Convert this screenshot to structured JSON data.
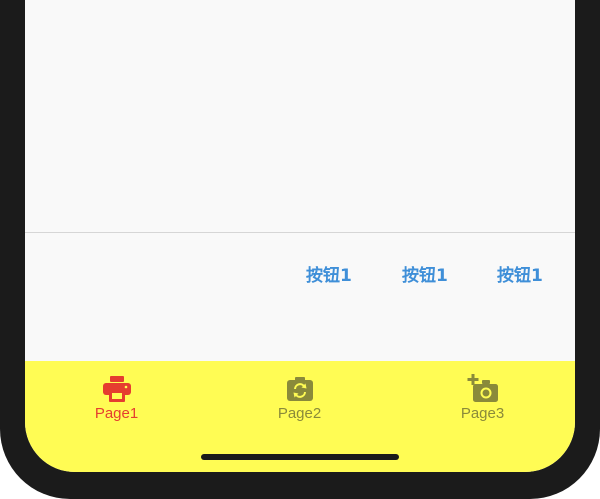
{
  "action_buttons": [
    {
      "label": "按钮1"
    },
    {
      "label": "按钮1"
    },
    {
      "label": "按钮1"
    }
  ],
  "tab_bar": {
    "background_color": "#fffc54",
    "active_color": "#e53d2f",
    "inactive_color": "#8a8a3a",
    "tabs": [
      {
        "label": "Page1",
        "icon": "printer-icon",
        "active": true
      },
      {
        "label": "Page2",
        "icon": "camera-switch-icon",
        "active": false
      },
      {
        "label": "Page3",
        "icon": "add-camera-icon",
        "active": false
      }
    ]
  },
  "colors": {
    "button_text": "#3f8fd8",
    "content_background": "#f9f9f9",
    "frame": "#1b1b1b"
  }
}
